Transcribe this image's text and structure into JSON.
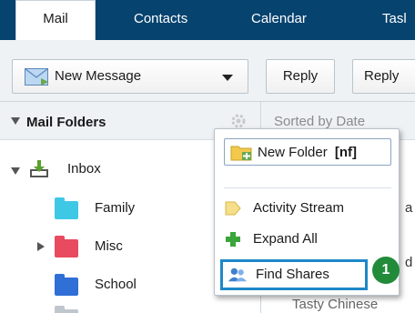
{
  "tabs": [
    "Mail",
    "Contacts",
    "Calendar",
    "Tasl"
  ],
  "toolbar": {
    "new_message": "New Message",
    "reply": "Reply",
    "reply_all": "Reply"
  },
  "folders": {
    "header": "Mail Folders",
    "items": [
      {
        "label": "Inbox",
        "color": "#6aa84f"
      },
      {
        "label": "Family",
        "color": "#3fc8e6"
      },
      {
        "label": "Misc",
        "color": "#e84a5f"
      },
      {
        "label": "School",
        "color": "#2f6fd6"
      }
    ]
  },
  "message_pane": {
    "sort_label": "Sorted by Date",
    "peek_1": "a",
    "peek_2": "d",
    "peek_3": "Tasty Chinese"
  },
  "context_menu": {
    "new_folder": "New Folder",
    "shortcut": "[nf]",
    "activity_stream": "Activity Stream",
    "expand_all": "Expand All",
    "find_shares": "Find Shares"
  },
  "badge": "1",
  "colors": {
    "tabbar": "#07436f",
    "highlight_border": "#1e88c8",
    "badge": "#228b3a"
  }
}
